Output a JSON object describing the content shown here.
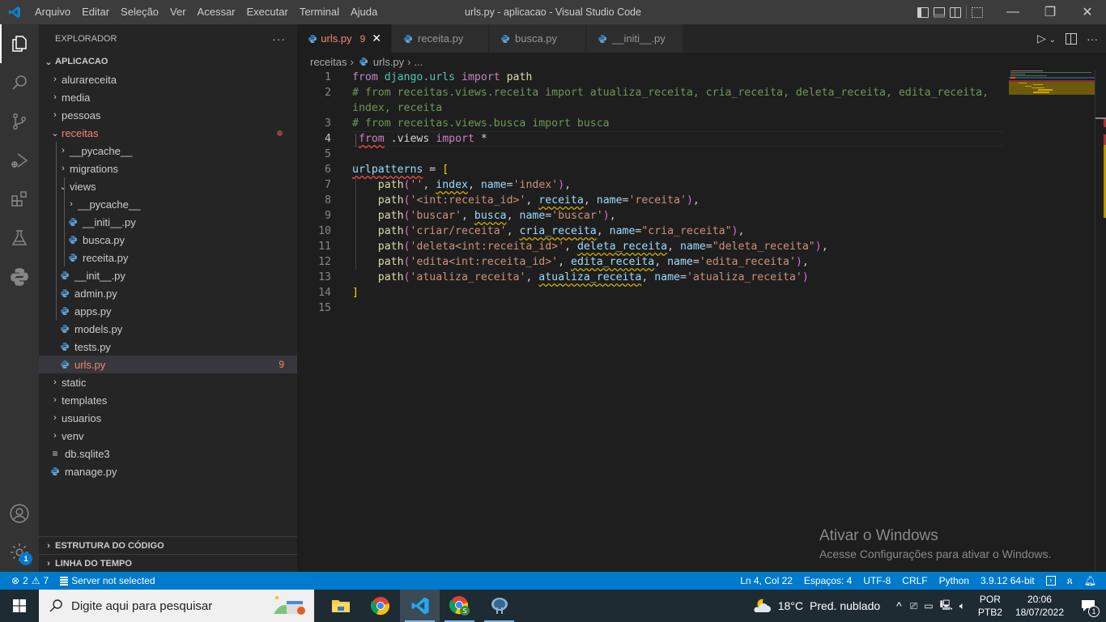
{
  "window": {
    "title": "urls.py - aplicacao - Visual Studio Code",
    "menu": [
      "Arquivo",
      "Editar",
      "Seleção",
      "Ver",
      "Acessar",
      "Executar",
      "Terminal",
      "Ajuda"
    ],
    "controls": {
      "minimize": "—",
      "restore": "❐",
      "close": "✕"
    }
  },
  "activity_bar": {
    "items": [
      "explorer-icon",
      "search-icon",
      "source-control-icon",
      "run-debug-icon",
      "extensions-icon",
      "testing-icon",
      "python-icon"
    ],
    "bottom": [
      "accounts-icon",
      "manage-gear-icon"
    ],
    "gear_badge": "1"
  },
  "sidebar": {
    "title": "EXPLORADOR",
    "more": "···",
    "root": "APLICACAO",
    "tree": [
      {
        "label": "alurareceita",
        "type": "folder",
        "open": false,
        "depth": 1
      },
      {
        "label": "media",
        "type": "folder",
        "open": false,
        "depth": 1
      },
      {
        "label": "pessoas",
        "type": "folder",
        "open": false,
        "depth": 1
      },
      {
        "label": "receitas",
        "type": "folder",
        "open": true,
        "depth": 1,
        "error": true,
        "dot": true
      },
      {
        "label": "__pycache__",
        "type": "folder",
        "open": false,
        "depth": 2
      },
      {
        "label": "migrations",
        "type": "folder",
        "open": false,
        "depth": 2
      },
      {
        "label": "views",
        "type": "folder",
        "open": true,
        "depth": 2
      },
      {
        "label": "__pycache__",
        "type": "folder",
        "open": false,
        "depth": 3
      },
      {
        "label": "__initi__.py",
        "type": "py",
        "depth": 3
      },
      {
        "label": "busca.py",
        "type": "py",
        "depth": 3
      },
      {
        "label": "receita.py",
        "type": "py",
        "depth": 3
      },
      {
        "label": "__init__.py",
        "type": "py",
        "depth": 2
      },
      {
        "label": "admin.py",
        "type": "py",
        "depth": 2
      },
      {
        "label": "apps.py",
        "type": "py",
        "depth": 2
      },
      {
        "label": "models.py",
        "type": "py",
        "depth": 2
      },
      {
        "label": "tests.py",
        "type": "py",
        "depth": 2
      },
      {
        "label": "urls.py",
        "type": "py",
        "depth": 2,
        "error": true,
        "selected": true,
        "count": "9"
      },
      {
        "label": "static",
        "type": "folder",
        "open": false,
        "depth": 1
      },
      {
        "label": "templates",
        "type": "folder",
        "open": false,
        "depth": 1
      },
      {
        "label": "usuarios",
        "type": "folder",
        "open": false,
        "depth": 1
      },
      {
        "label": "venv",
        "type": "folder",
        "open": false,
        "depth": 1
      },
      {
        "label": "db.sqlite3",
        "type": "file",
        "depth": 1
      },
      {
        "label": "manage.py",
        "type": "py",
        "depth": 1
      }
    ],
    "sections": [
      "ESTRUTURA DO CÓDIGO",
      "LINHA DO TEMPO"
    ]
  },
  "tabs": [
    {
      "label": "urls.py",
      "active": true,
      "problems": "9",
      "close": "✕"
    },
    {
      "label": "receita.py",
      "active": false
    },
    {
      "label": "busca.py",
      "active": false
    },
    {
      "label": "__initi__.py",
      "active": false
    }
  ],
  "breadcrumb": [
    "receitas",
    "urls.py",
    "..."
  ],
  "editor": {
    "lines": [
      {
        "n": "1",
        "html": "<span class='k'>from</span> <span class='mod'>django.urls</span> <span class='k'>import</span> <span class='f'>path</span>"
      },
      {
        "n": "2",
        "html": "<span class='c'># from receitas.views.receita import atualiza_receita, cria_receita, deleta_receita, edita_receita,</span>"
      },
      {
        "n": "",
        "html": "<span class='c'>index, receita</span>"
      },
      {
        "n": "3",
        "html": "<span class='c'># from receitas.views.busca import busca</span>"
      },
      {
        "n": "4",
        "html": " <span class='k sq-r'>from</span> <span class='w'>.views</span> <span class='k'>import</span> <span class='w'>*</span>",
        "current": true
      },
      {
        "n": "5",
        "html": ""
      },
      {
        "n": "6",
        "html": "<span class='v sq-r'>urlpatterns</span> <span class='p'>=</span> <span class='b'>[</span>"
      },
      {
        "n": "7",
        "html": "    <span class='f'>path</span><span class='pb'>(</span><span class='s'>''</span>, <span class='v sq-y'>index</span>, <span class='v'>name</span>=<span class='s'>'index'</span><span class='pb'>)</span>,"
      },
      {
        "n": "8",
        "html": "    <span class='f'>path</span><span class='pb'>(</span><span class='s'>'&lt;int:receita_id&gt;'</span>, <span class='v sq-y'>receita</span>, <span class='v'>name</span>=<span class='s'>'receita'</span><span class='pb'>)</span>,"
      },
      {
        "n": "9",
        "html": "    <span class='f'>path</span><span class='pb'>(</span><span class='s'>'buscar'</span>, <span class='v sq-y'>busca</span>, <span class='v'>name</span>=<span class='s'>'buscar'</span><span class='pb'>)</span>,"
      },
      {
        "n": "10",
        "html": "    <span class='f'>path</span><span class='pb'>(</span><span class='s'>'criar/receita'</span>, <span class='v sq-y'>cria_receita</span>, <span class='v'>name</span>=<span class='s'>\"cria_receita\"</span><span class='pb'>)</span>,"
      },
      {
        "n": "11",
        "html": "    <span class='f'>path</span><span class='pb'>(</span><span class='s'>'deleta&lt;int:receita_id&gt;'</span>, <span class='v sq-y'>deleta_receita</span>, <span class='v'>name</span>=<span class='s'>\"deleta_receita\"</span><span class='pb'>)</span>,"
      },
      {
        "n": "12",
        "html": "    <span class='f'>path</span><span class='pb'>(</span><span class='s'>'edita&lt;int:receita_id&gt;'</span>, <span class='v sq-y'>edita_receita</span>, <span class='v'>name</span>=<span class='s'>'edita_receita'</span><span class='pb'>)</span>,"
      },
      {
        "n": "13",
        "html": "    <span class='f'>path</span><span class='pb'>(</span><span class='s'>'atualiza_receita'</span>, <span class='v sq-y'>atualiza_receita</span>, <span class='v'>name</span>=<span class='s'>'atualiza_receita'</span><span class='pb'>)</span>"
      },
      {
        "n": "14",
        "html": "<span class='b'>]</span>"
      },
      {
        "n": "15",
        "html": ""
      }
    ]
  },
  "watermark": {
    "title": "Ativar o Windows",
    "subtitle": "Acesse Configurações para ativar o Windows."
  },
  "statusbar": {
    "errors": "2",
    "warnings": "7",
    "server": "Server not selected",
    "position": "Ln 4, Col 22",
    "spaces": "Espaços: 4",
    "encoding": "UTF-8",
    "eol": "CRLF",
    "language": "Python",
    "interpreter": "3.9.12 64-bit"
  },
  "taskbar": {
    "search_placeholder": "Digite aqui para pesquisar",
    "apps": [
      "file-explorer-icon",
      "chrome-icon",
      "vscode-icon",
      "chrome-profile-icon",
      "pgadmin-icon"
    ],
    "weather": {
      "temp": "18°C",
      "desc": "Pred. nublado"
    },
    "lang": [
      "POR",
      "PTB2"
    ],
    "time": "20:06",
    "date": "18/07/2022",
    "notifications": "1"
  },
  "colors": {
    "accent": "#007acc",
    "error": "#f48771",
    "titlebar": "#3c3c3c"
  }
}
